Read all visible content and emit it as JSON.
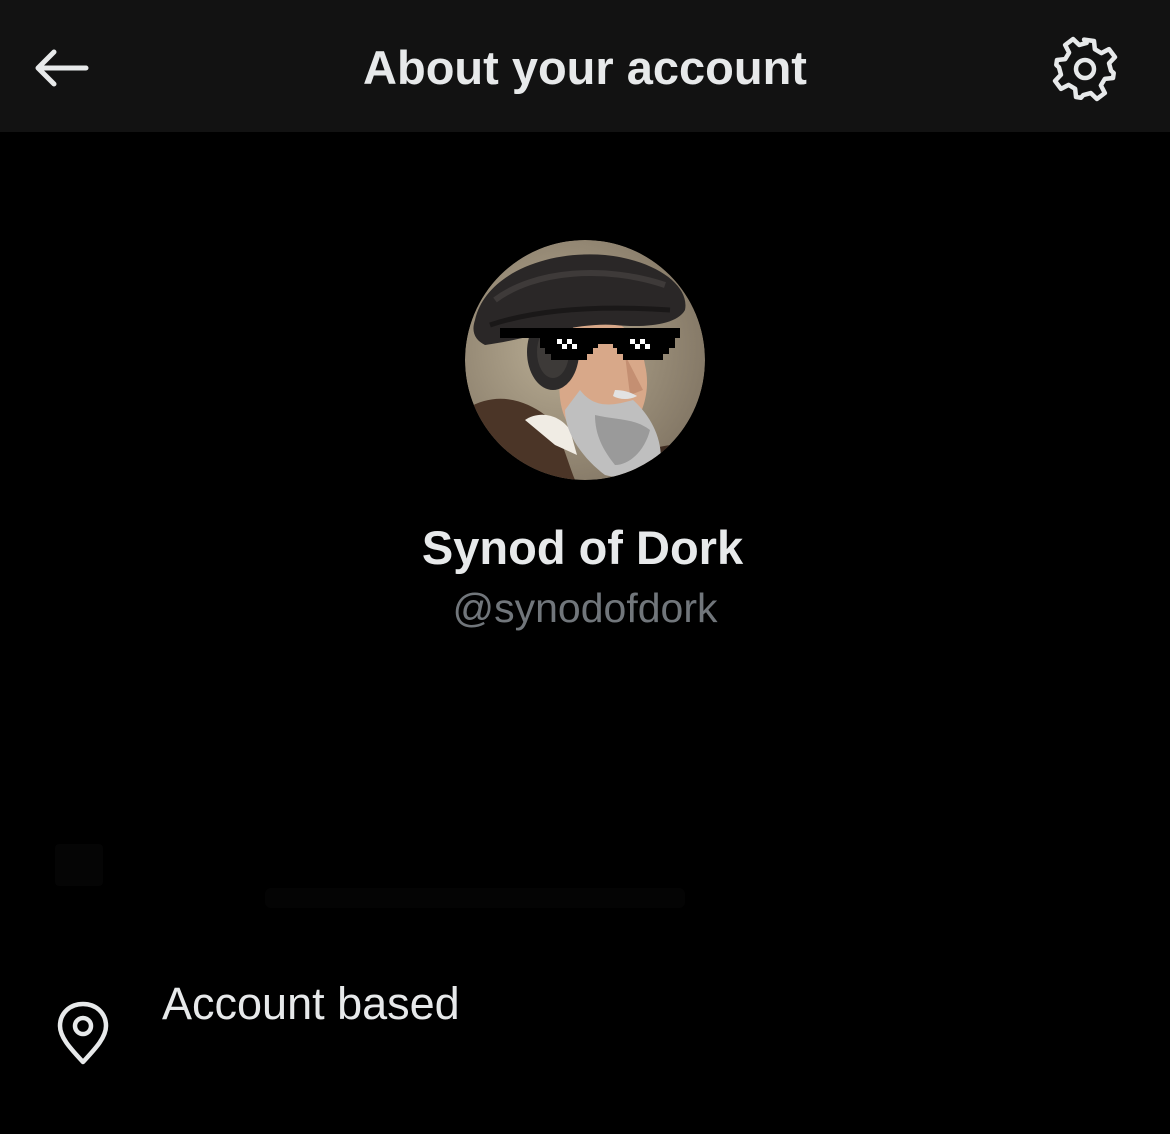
{
  "header": {
    "title": "About your account",
    "back_icon": "arrow-left-icon",
    "settings_icon": "gear-icon"
  },
  "profile": {
    "display_name": "Synod of Dork",
    "handle": "@synodofdork",
    "avatar_icon": "avatar-portrait"
  },
  "details": {
    "location_icon": "map-pin-icon",
    "location_label": "Account based"
  },
  "colors": {
    "background": "#000000",
    "header_background": "#121212",
    "primary_text": "#e7e9ea",
    "secondary_text": "#71767b"
  }
}
